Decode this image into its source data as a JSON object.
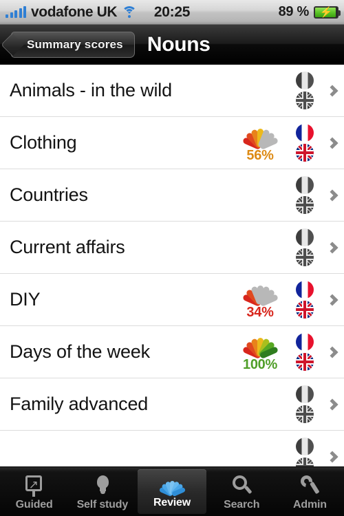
{
  "status_bar": {
    "carrier": "vodafone UK",
    "time": "20:25",
    "battery_percent": "89 %",
    "battery_charging": true,
    "signal_bars": 5,
    "wifi_icon": "wifi-icon",
    "battery_icon": "battery-charging-icon"
  },
  "nav_bar": {
    "back_label": "Summary scores",
    "title": "Nouns"
  },
  "list": {
    "rows": [
      {
        "title": "Animals - in the wild",
        "score": null,
        "score_label": "",
        "has_score": false,
        "flags_active": false
      },
      {
        "title": "Clothing",
        "score": 56,
        "score_label": "56%",
        "has_score": true,
        "flags_active": true
      },
      {
        "title": "Countries",
        "score": null,
        "score_label": "",
        "has_score": false,
        "flags_active": false
      },
      {
        "title": "Current affairs",
        "score": null,
        "score_label": "",
        "has_score": false,
        "flags_active": false
      },
      {
        "title": "DIY",
        "score": 34,
        "score_label": "34%",
        "has_score": true,
        "flags_active": true
      },
      {
        "title": "Days of the week",
        "score": 100,
        "score_label": "100%",
        "has_score": true,
        "flags_active": true
      },
      {
        "title": "Family advanced",
        "score": null,
        "score_label": "",
        "has_score": false,
        "flags_active": false
      },
      {
        "title": "",
        "score": null,
        "score_label": "",
        "has_score": false,
        "flags_active": false
      }
    ],
    "flag_top": "french-flag-icon",
    "flag_bottom": "uk-flag-icon",
    "disclosure_icon": "chevron-right-icon"
  },
  "gauge": {
    "segments": 7,
    "filled_colors": [
      "#d8261c",
      "#e0491f",
      "#e8821c",
      "#ecb91c",
      "#a8bf1e",
      "#57a822",
      "#2f7d1f"
    ],
    "empty_color": "#b8b8b8",
    "text_colors": {
      "low": "#d8261c",
      "mid": "#dd8a14",
      "high": "#4f9e28"
    }
  },
  "tab_bar": {
    "tabs": [
      {
        "label": "Guided",
        "icon": "guided-arrow-icon",
        "selected": false
      },
      {
        "label": "Self study",
        "icon": "lightbulb-icon",
        "selected": false
      },
      {
        "label": "Review",
        "icon": "review-petals-icon",
        "selected": true
      },
      {
        "label": "Search",
        "icon": "search-icon",
        "selected": false
      },
      {
        "label": "Admin",
        "icon": "wrench-icon",
        "selected": false
      }
    ],
    "selected_icon_color": "#37a4e8"
  }
}
